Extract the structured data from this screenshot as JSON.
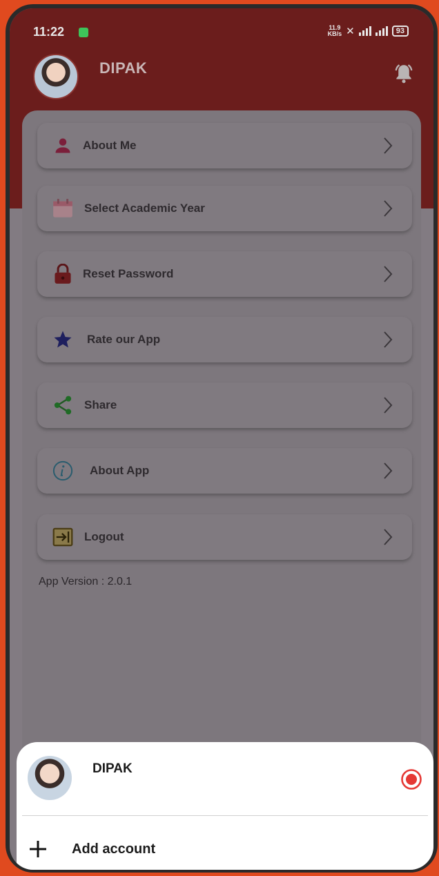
{
  "status_bar": {
    "time": "11:22",
    "net_speed_top": "11.9",
    "net_speed_bottom": "KB/s",
    "battery": "93"
  },
  "header": {
    "user_name": "DIPAK"
  },
  "menu": {
    "items": [
      {
        "label": "About Me",
        "icon": "user-icon"
      },
      {
        "label": "Select Academic Year",
        "icon": "calendar-icon"
      },
      {
        "label": "Reset Password",
        "icon": "lock-icon"
      },
      {
        "label": "Rate our App",
        "icon": "star-icon"
      },
      {
        "label": "Share",
        "icon": "share-icon"
      },
      {
        "label": "About App",
        "icon": "info-icon"
      },
      {
        "label": "Logout",
        "icon": "logout-icon"
      }
    ]
  },
  "version_text": "App Version : 2.0.1",
  "account_sheet": {
    "account_name": "DIPAK",
    "add_account_label": "Add account"
  },
  "colors": {
    "header": "#6b1d1c",
    "accent_red": "#e53935",
    "overlay": "#827b82",
    "frame_orange": "#e04a1f"
  }
}
